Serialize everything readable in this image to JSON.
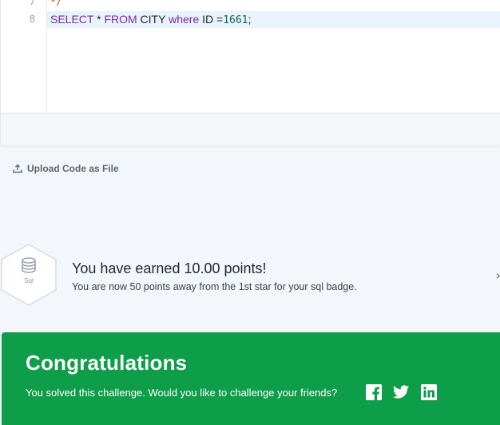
{
  "editor": {
    "lines": [
      {
        "number": "7",
        "comment": "*/"
      },
      {
        "number": "8",
        "kw1": "SELECT",
        "t1": " * ",
        "kw2": "FROM",
        "t2": " CITY ",
        "kw3": "where",
        "t3": " ID =",
        "num": "1661",
        "t4": ";"
      }
    ]
  },
  "upload": {
    "label": "Upload Code as File",
    "icon": "upload-icon"
  },
  "points": {
    "badge_icon": "database-icon",
    "badge_label": "Sql",
    "title": "You have earned 10.00 points!",
    "subtitle": "You are now 50 points away from the 1st star for your sql badge."
  },
  "congrats": {
    "title": "Congratulations",
    "text": "You solved this challenge. Would you like to challenge your friends?",
    "share_icons": [
      "facebook-icon",
      "twitter-icon",
      "linkedin-icon"
    ]
  },
  "colors": {
    "congrats_bg": "#0e9d48",
    "active_line": "#e9f3fc"
  }
}
